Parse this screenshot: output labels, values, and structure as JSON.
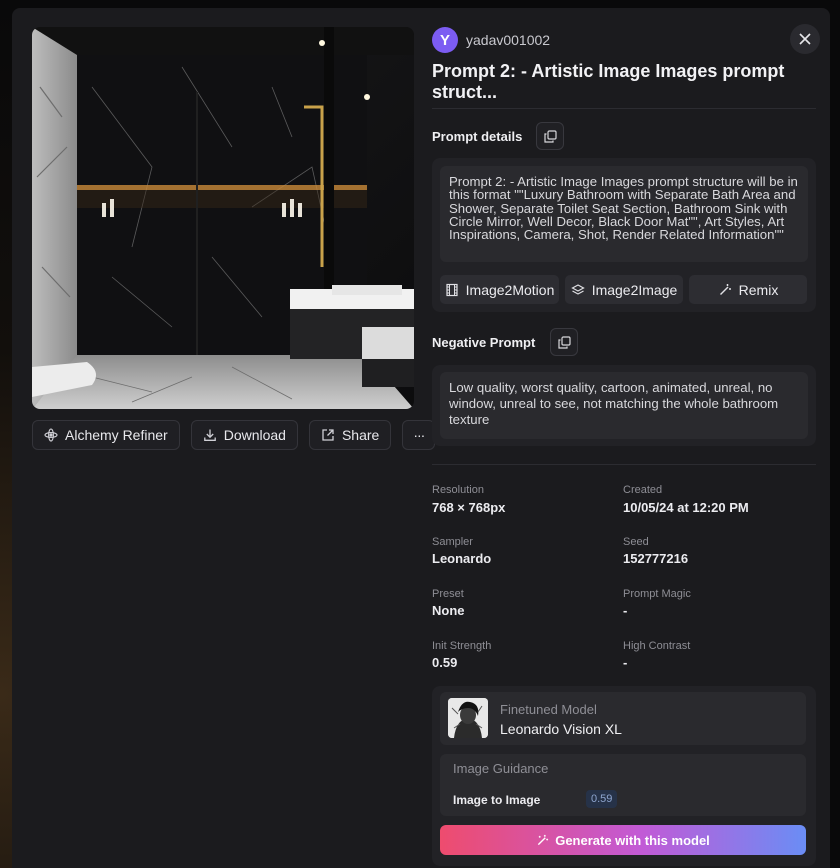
{
  "user": {
    "avatar_letter": "Y",
    "name": "yadav001002"
  },
  "title": "Prompt 2: - Artistic Image Images prompt struct...",
  "prompt_section": {
    "label": "Prompt details",
    "text": "Prompt 2: - Artistic Image Images prompt structure will be in this format \"\"Luxury Bathroom with Separate Bath Area and Shower, Separate Toilet Seat Section, Bathroom Sink with Circle Mirror, Well Decor, Black Door Mat\"\", Art Styles, Art Inspirations, Camera, Shot, Render Related Information\"\""
  },
  "tools": {
    "image2motion": "Image2Motion",
    "image2image": "Image2Image",
    "remix": "Remix"
  },
  "negative_section": {
    "label": "Negative Prompt",
    "text": "Low quality, worst quality, cartoon, animated, unreal, no window, unreal to see, not matching the whole bathroom texture"
  },
  "actions": {
    "refiner": "Alchemy Refiner",
    "download": "Download",
    "share": "Share",
    "more": "···"
  },
  "meta": [
    {
      "label": "Resolution",
      "value": "768 × 768px"
    },
    {
      "label": "Created",
      "value": "10/05/24 at 12:20 PM"
    },
    {
      "label": "Sampler",
      "value": "Leonardo"
    },
    {
      "label": "Seed",
      "value": "152777216"
    },
    {
      "label": "Preset",
      "value": "None"
    },
    {
      "label": "Prompt Magic",
      "value": "-"
    },
    {
      "label": "Init Strength",
      "value": "0.59"
    },
    {
      "label": "High Contrast",
      "value": "-"
    }
  ],
  "model": {
    "label": "Finetuned Model",
    "name": "Leonardo Vision XL"
  },
  "guidance": {
    "title": "Image Guidance",
    "label": "Image to Image",
    "value": "0.59"
  },
  "generate_label": "Generate with this model",
  "colors": {
    "accent_start": "#ee4c6e",
    "accent_end": "#6a8df5",
    "avatar": "#7c5cf2"
  }
}
